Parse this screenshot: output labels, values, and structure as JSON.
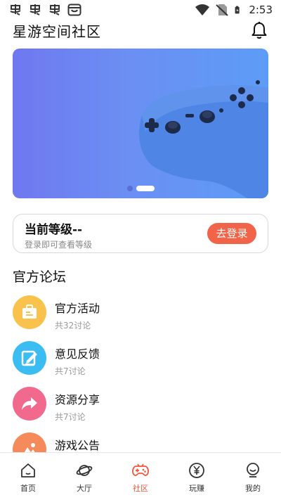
{
  "status_bar": {
    "time": "2:53",
    "left_icons": [
      "app-notification-icon",
      "app-notification-icon",
      "app-notification-icon",
      "store-notification-icon"
    ],
    "right_icons": [
      "wifi-icon",
      "no-sim-icon",
      "battery-charging-icon"
    ]
  },
  "header": {
    "title": "星游空间社区",
    "bell_icon": "bell-icon"
  },
  "banner": {
    "image": "game-controller",
    "slide_count": 2,
    "active_slide": 2,
    "colors": {
      "gradient_start": "#6f78ef",
      "gradient_end": "#5c9cf7"
    }
  },
  "level_card": {
    "title": "当前等级--",
    "subtitle": "登录即可查看等级",
    "login_label": "去登录",
    "accent": "#f2644a"
  },
  "forum": {
    "title": "官方论坛",
    "items": [
      {
        "name": "官方活动",
        "count": "共32讨论",
        "icon": "activity-icon",
        "color": "#f8c24c"
      },
      {
        "name": "意见反馈",
        "count": "共7讨论",
        "icon": "feedback-edit-icon",
        "color": "#3bbdf2"
      },
      {
        "name": "资源分享",
        "count": "共7讨论",
        "icon": "share-arrow-icon",
        "color": "#f1698c"
      },
      {
        "name": "游戏公告",
        "count": "",
        "icon": "announcement-icon",
        "color": "#f58a5a"
      }
    ]
  },
  "tabbar": {
    "tabs": [
      {
        "label": "首页",
        "icon": "home-icon",
        "active": false
      },
      {
        "label": "大厅",
        "icon": "planet-icon",
        "active": false
      },
      {
        "label": "社区",
        "icon": "gamepad-icon",
        "active": true
      },
      {
        "label": "玩赚",
        "icon": "yuan-coin-icon",
        "active": false
      },
      {
        "label": "我的",
        "icon": "profile-icon",
        "active": false
      }
    ],
    "active_color": "#f0563b"
  }
}
